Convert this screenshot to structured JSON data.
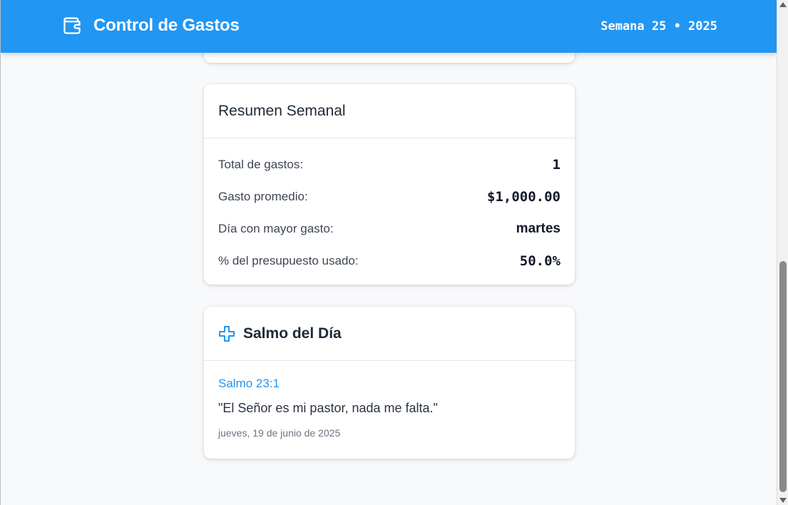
{
  "header": {
    "title": "Control de Gastos",
    "week": "Semana 25 • 2025",
    "icon": "wallet-icon",
    "background_color": "#2196f3"
  },
  "summary": {
    "title": "Resumen Semanal",
    "stats": [
      {
        "label": "Total de gastos:",
        "value": "1"
      },
      {
        "label": "Gasto promedio:",
        "value": "$1,000.00"
      },
      {
        "label": "Día con mayor gasto:",
        "value": "martes"
      },
      {
        "label": "% del presupuesto usado:",
        "value": "50.0%"
      }
    ]
  },
  "psalm": {
    "title": "Salmo del Día",
    "icon": "cross-icon",
    "reference": "Salmo 23:1",
    "quote": "\"El Señor es mi pastor, nada me falta.\"",
    "date": "jueves, 19 de junio de 2025",
    "accent_color": "#2196f3"
  },
  "scrollbar": {
    "scroll_fraction": 0.95
  }
}
